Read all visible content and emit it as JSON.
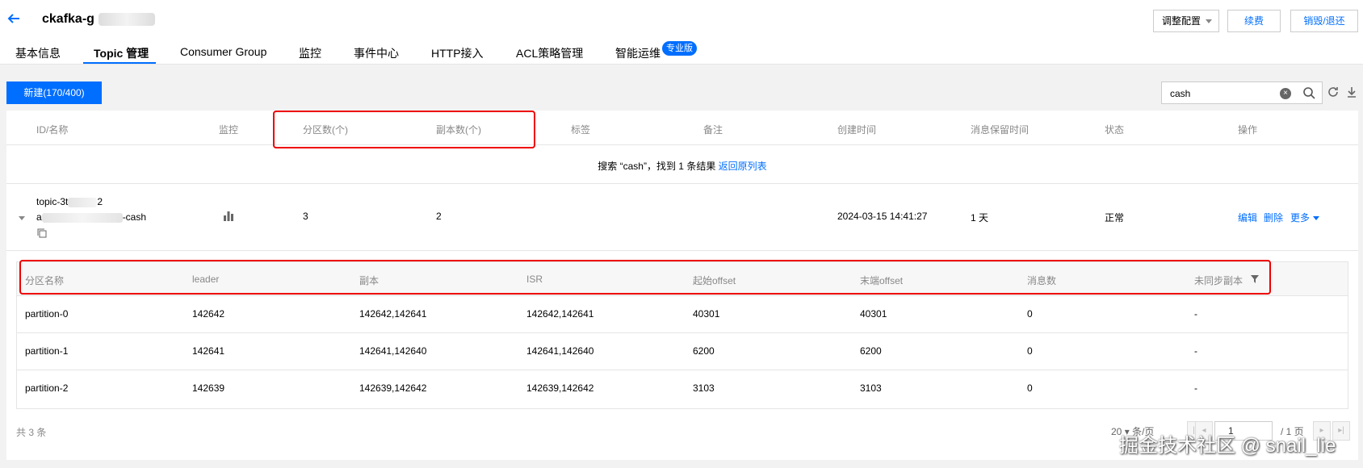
{
  "header": {
    "instance_title": "ckafka-g",
    "buttons": {
      "adjust": "调整配置",
      "renew": "续费",
      "destroy": "销毁/退还"
    },
    "tabs": [
      "基本信息",
      "Topic 管理",
      "Consumer Group",
      "监控",
      "事件中心",
      "HTTP接入",
      "ACL策略管理",
      "智能运维"
    ],
    "pro_badge": "专业版"
  },
  "toolbar": {
    "new_button": "新建(170/400)",
    "search_value": "cash",
    "clear_glyph": "×"
  },
  "table": {
    "columns": [
      "ID/名称",
      "监控",
      "分区数(个)",
      "副本数(个)",
      "标签",
      "备注",
      "创建时间",
      "消息保留时间",
      "状态",
      "操作"
    ],
    "result": {
      "text": "搜索 “cash”，找到 1 条结果",
      "link": "返回原列表"
    },
    "row": {
      "id_prefix": "topic-3t",
      "id_suffix": "2",
      "name_prefix": "a",
      "name_suffix": "-cash",
      "partitions": "3",
      "replicas": "2",
      "created": "2024-03-15 14:41:27",
      "retention": "1 天",
      "status": "正常",
      "ops": {
        "edit": "编辑",
        "delete": "删除",
        "more": "更多"
      }
    }
  },
  "partitions": {
    "columns": [
      "分区名称",
      "leader",
      "副本",
      "ISR",
      "起始offset",
      "末端offset",
      "消息数",
      "未同步副本"
    ],
    "rows": [
      [
        "partition-0",
        "142642",
        "142642,142641",
        "142642,142641",
        "40301",
        "40301",
        "0",
        "-"
      ],
      [
        "partition-1",
        "142641",
        "142641,142640",
        "142641,142640",
        "6200",
        "6200",
        "0",
        "-"
      ],
      [
        "partition-2",
        "142639",
        "142639,142642",
        "142639,142642",
        "3103",
        "3103",
        "0",
        "-"
      ]
    ]
  },
  "footer": {
    "total": "共 3 条",
    "page_size": "20",
    "page_size_unit": "条/页",
    "page_current": "1",
    "page_total": "/ 1 页"
  },
  "watermark": "掘金技术社区 @ snail_lie",
  "colors": {
    "accent": "#006eff",
    "highlight": "#e00000"
  }
}
